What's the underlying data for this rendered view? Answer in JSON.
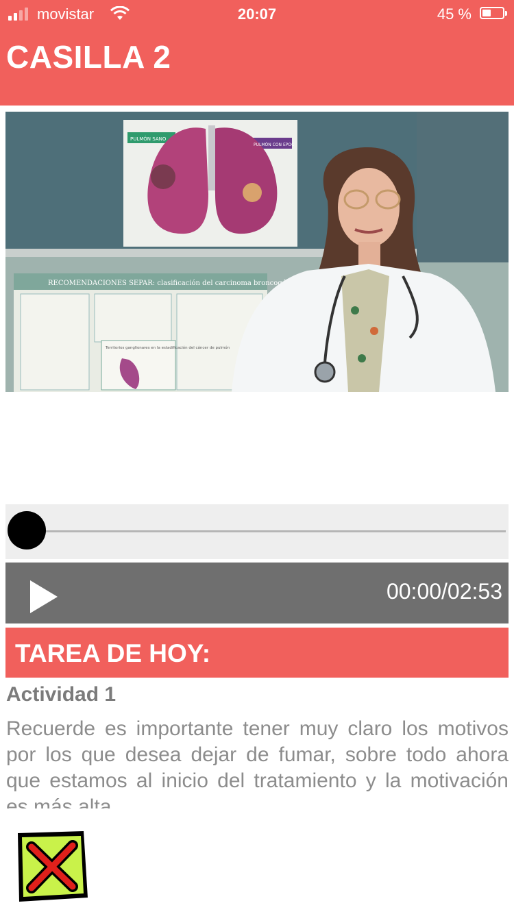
{
  "status_bar": {
    "carrier": "movistar",
    "time": "20:07",
    "battery": "45 %"
  },
  "header": {
    "title": "CASILLA 2"
  },
  "video": {
    "poster": {
      "poster_left_title": "PULMÓN SANO",
      "poster_right_title": "PULMÓN CON EPOC",
      "poster_bottom_title": "RECOMENDACIONES SEPAR: clasificación del carcinoma broncogénico",
      "poster_box_text": "Territorios ganglionares en la estadificación del cáncer de pulmón"
    }
  },
  "player": {
    "time_display": "00:00/02:53",
    "progress": 0
  },
  "task": {
    "title": "TAREA DE HOY:",
    "activity_label": "Actividad 1",
    "description": "Recuerde es importante tener muy claro los motivos por los que desea dejar de fumar, sobre todo ahora que estamos al inicio del tratamiento y la motivación es más alta."
  },
  "icons": {
    "play": "play-icon",
    "close": "close-x-icon"
  },
  "colors": {
    "brand_red": "#f1605c",
    "controls_gray": "#6f6f6f",
    "close_green": "#c9f24a",
    "close_red": "#e0201b"
  }
}
